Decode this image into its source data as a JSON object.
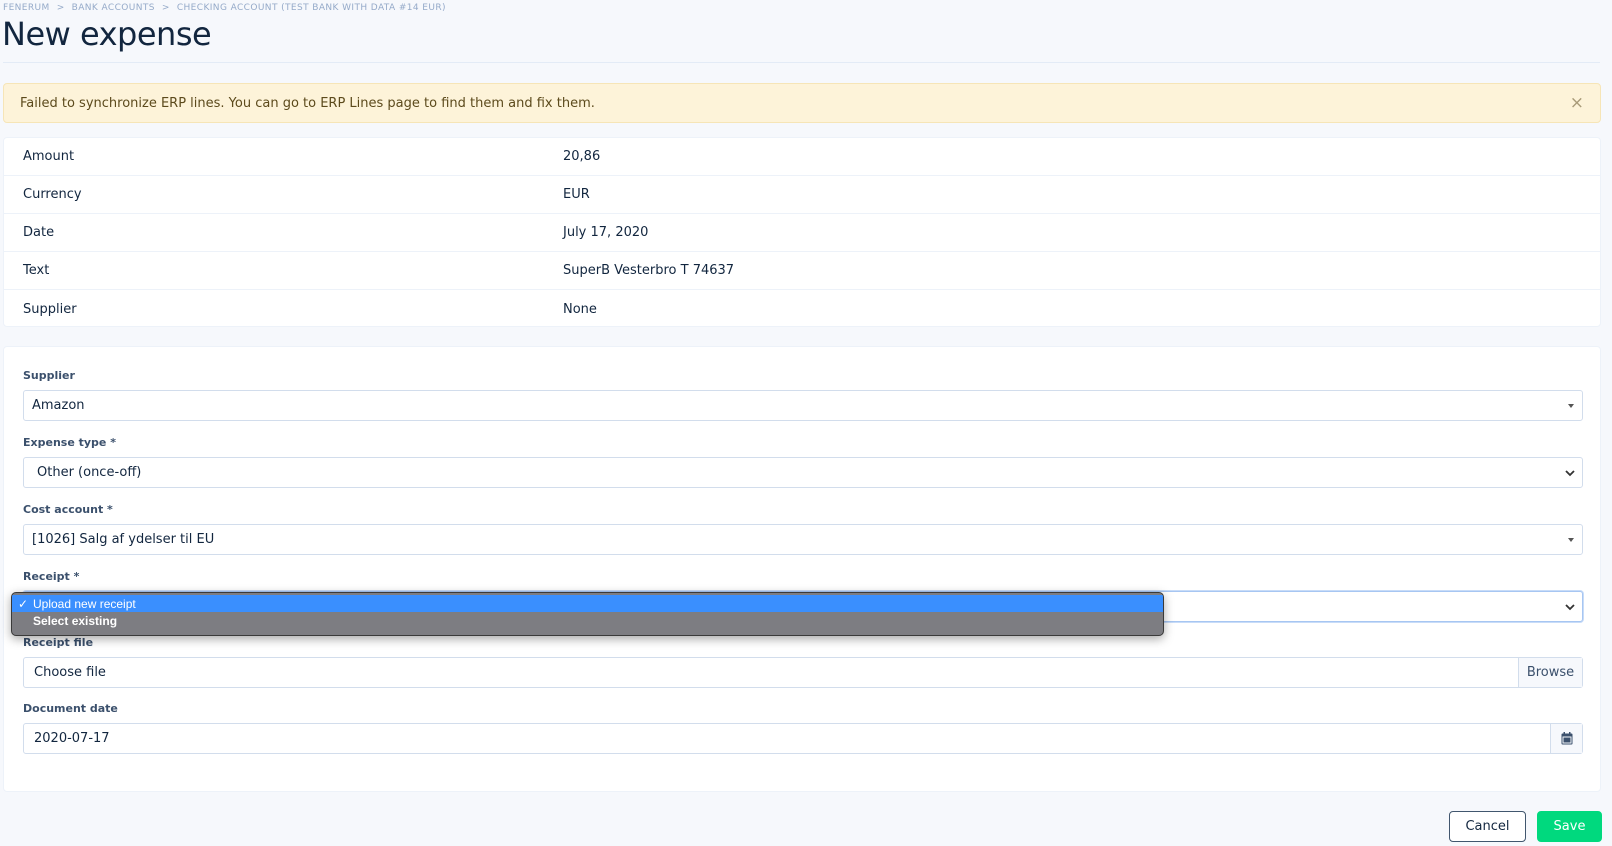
{
  "breadcrumb": [
    "FENERUM",
    "BANK ACCOUNTS",
    "CHECKING ACCOUNT (TEST BANK WITH DATA #14 EUR)"
  ],
  "page_title": "New expense",
  "alert": {
    "message": "Failed to synchronize ERP lines. You can go to ERP Lines page to find them and fix them.",
    "close_glyph": "×"
  },
  "details": [
    {
      "label": "Amount",
      "value": "20,86"
    },
    {
      "label": "Currency",
      "value": "EUR"
    },
    {
      "label": "Date",
      "value": "July 17, 2020"
    },
    {
      "label": "Text",
      "value": "SuperB Vesterbro T 74637"
    },
    {
      "label": "Supplier",
      "value": "None"
    }
  ],
  "form": {
    "supplier": {
      "label": "Supplier",
      "value": "Amazon"
    },
    "expense_type": {
      "label": "Expense type *",
      "value": "Other (once-off)"
    },
    "cost_account": {
      "label": "Cost account *",
      "value": "[1026] Salg af ydelser til EU"
    },
    "receipt": {
      "label": "Receipt *",
      "options": [
        "Upload new receipt",
        "Select existing"
      ],
      "selected": "Upload new receipt"
    },
    "receipt_file": {
      "label": "Receipt file",
      "placeholder": "Choose file",
      "button": "Browse"
    },
    "document_date": {
      "label": "Document date",
      "value": "2020-07-17"
    }
  },
  "actions": {
    "cancel": "Cancel",
    "save": "Save"
  },
  "icons": {
    "calendar": "calendar-icon",
    "close": "close-icon",
    "check": "check-icon"
  },
  "colors": {
    "save": "#00d97e",
    "alert_bg": "#fdf3d9",
    "dropdown_selected": "#3a8ffe"
  }
}
